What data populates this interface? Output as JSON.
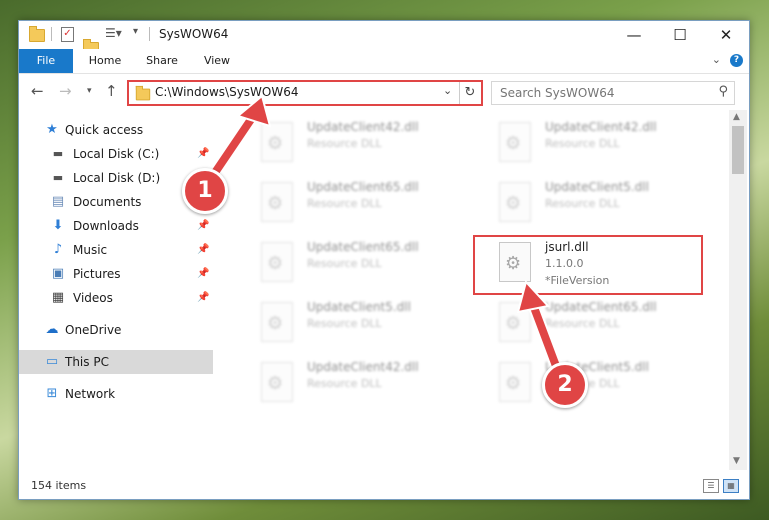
{
  "window": {
    "title": "SysWOW64",
    "minimize": "—",
    "maximize": "☐",
    "close": "✕"
  },
  "ribbon": {
    "tabs": [
      {
        "label": "File"
      },
      {
        "label": "Home"
      },
      {
        "label": "Share"
      },
      {
        "label": "View"
      }
    ],
    "help": "?"
  },
  "address": {
    "path": "C:\\Windows\\SysWOW64"
  },
  "search": {
    "placeholder": "Search SysWOW64"
  },
  "sidebar": {
    "items": [
      {
        "label": "Quick access",
        "icon": "star-icon"
      },
      {
        "label": "Local Disk (C:)",
        "icon": "drive-icon"
      },
      {
        "label": "Local Disk (D:)",
        "icon": "drive-icon"
      },
      {
        "label": "Documents",
        "icon": "documents-icon"
      },
      {
        "label": "Downloads",
        "icon": "downloads-icon"
      },
      {
        "label": "Music",
        "icon": "music-icon"
      },
      {
        "label": "Pictures",
        "icon": "pictures-icon"
      },
      {
        "label": "Videos",
        "icon": "videos-icon"
      },
      {
        "label": "OneDrive",
        "icon": "cloud-icon"
      },
      {
        "label": "This PC",
        "icon": "computer-icon"
      },
      {
        "label": "Network",
        "icon": "network-icon"
      }
    ]
  },
  "files": [
    {
      "name": "UpdateClient42.dll",
      "type": "Resource DLL"
    },
    {
      "name": "UpdateClient42.dll",
      "type": "Resource DLL"
    },
    {
      "name": "UpdateClient65.dll",
      "type": "Resource DLL"
    },
    {
      "name": "UpdateClient5.dll",
      "type": "Resource DLL"
    },
    {
      "name": "UpdateClient65.dll",
      "type": "Resource DLL"
    },
    {
      "name": "UpdateClient5.dll",
      "type": "Resource DLL"
    },
    {
      "name": "UpdateClient65.dll",
      "type": "Resource DLL"
    },
    {
      "name": "UpdateClient42.dll",
      "type": "Resource DLL"
    },
    {
      "name": "UpdateClient5.dll",
      "type": "Resource DLL"
    }
  ],
  "target_file": {
    "name": "jsurl.dll",
    "version": "1.1.0.0",
    "version_label": "*FileVersion"
  },
  "status": {
    "count": "154 items"
  },
  "annotations": {
    "step1": "1",
    "step2": "2",
    "color": "#e04545"
  }
}
